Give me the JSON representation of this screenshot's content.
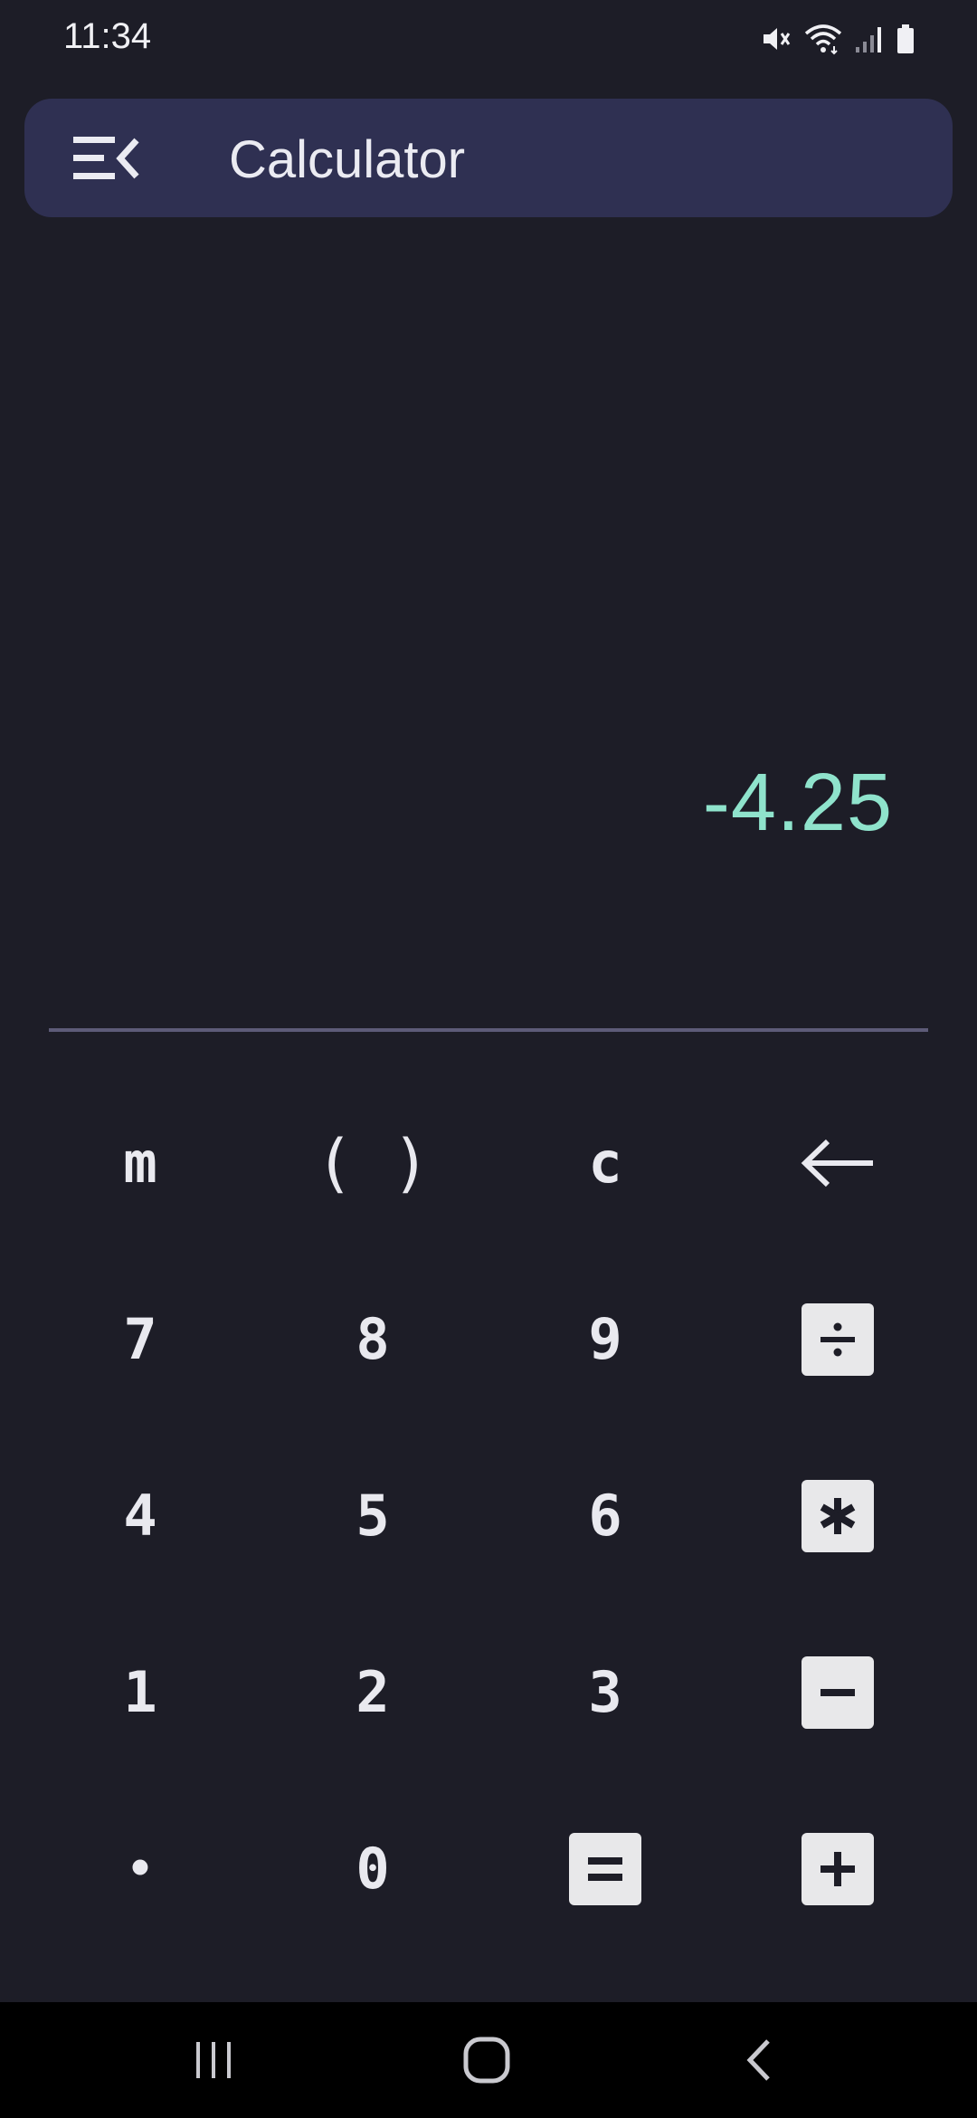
{
  "status": {
    "time": "11:34",
    "icons": [
      "mute-icon",
      "wifi-icon",
      "signal-icon",
      "battery-icon"
    ]
  },
  "header": {
    "title": "Calculator",
    "menu_icon": "menu-collapse-icon",
    "background": "#2f3052"
  },
  "display": {
    "value": "-4.25",
    "color": "#8fe3cc"
  },
  "keypad": {
    "row1": [
      "m",
      "( )",
      "c",
      "backspace-icon"
    ],
    "row2": [
      "7",
      "8",
      "9",
      "divide-icon"
    ],
    "row3": [
      "4",
      "5",
      "6",
      "multiply-icon"
    ],
    "row4": [
      "1",
      "2",
      "3",
      "minus-icon"
    ],
    "row5": [
      "•",
      "0",
      "equals-icon",
      "plus-icon"
    ],
    "labels": {
      "m": "m",
      "paren": "( )",
      "clear": "c",
      "seven": "7",
      "eight": "8",
      "nine": "9",
      "four": "4",
      "five": "5",
      "six": "6",
      "one": "1",
      "two": "2",
      "three": "3",
      "dot": "•",
      "zero": "0"
    }
  },
  "nav": {
    "buttons": [
      "recent-apps-icon",
      "home-icon",
      "back-icon"
    ]
  },
  "colors": {
    "background": "#1d1d27",
    "accent": "#8fe3cc",
    "divider": "#5d5b78",
    "nav_background": "#000000"
  }
}
